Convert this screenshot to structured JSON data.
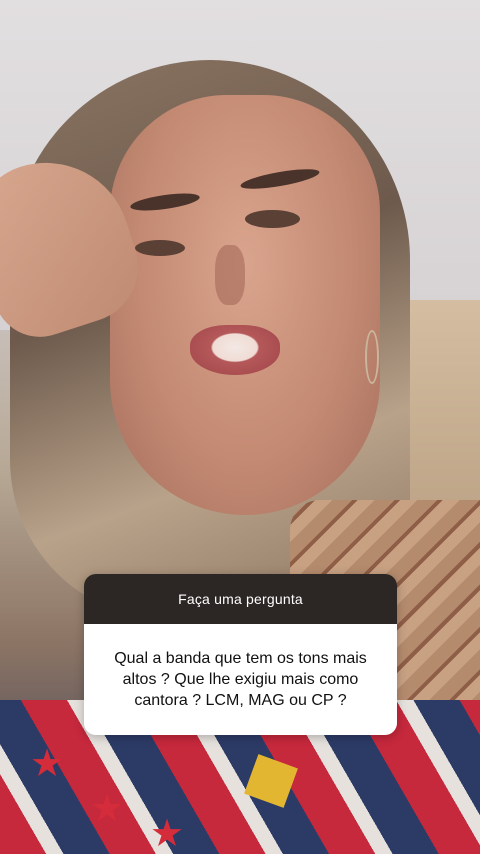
{
  "question_sticker": {
    "header": "Faça uma pergunta",
    "question": "Qual a banda que tem os tons mais altos ? Que lhe exigiu mais como cantora ? LCM, MAG ou CP ?"
  }
}
